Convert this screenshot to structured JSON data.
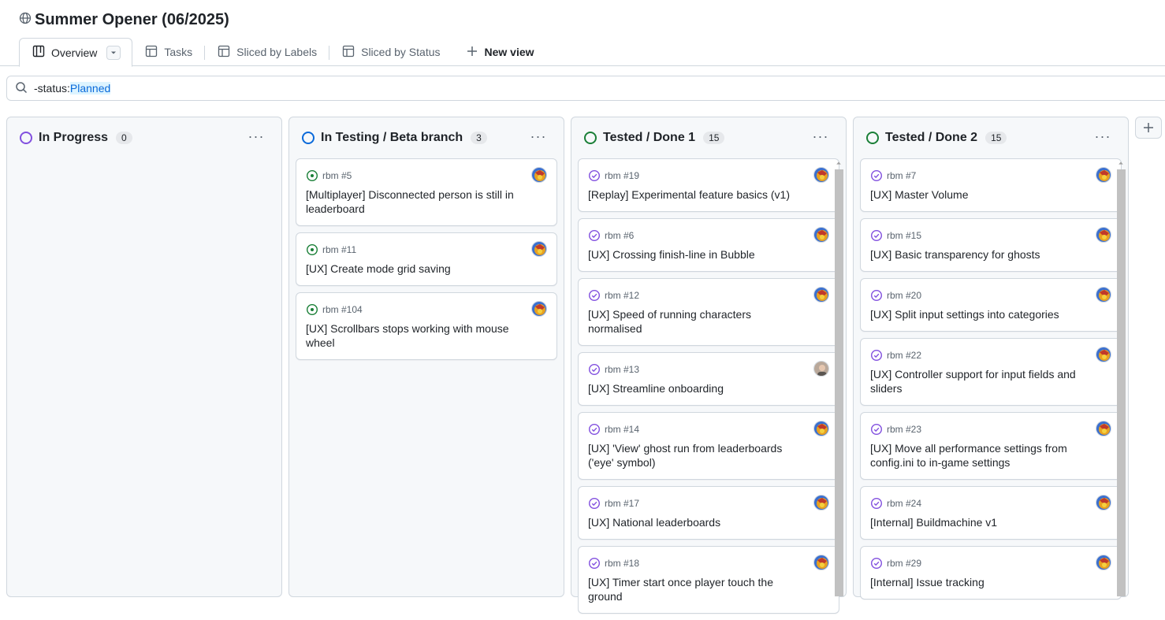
{
  "project": {
    "title": "Summer Opener (06/2025)"
  },
  "tabs": [
    {
      "label": "Overview",
      "icon": "board-icon",
      "active": true
    },
    {
      "label": "Tasks",
      "icon": "table-icon"
    },
    {
      "label": "Sliced by Labels",
      "icon": "table-icon"
    },
    {
      "label": "Sliced by Status",
      "icon": "table-icon"
    }
  ],
  "new_view_label": "New view",
  "filter": {
    "key": "-status:",
    "value": "Planned"
  },
  "columns": [
    {
      "name": "In Progress",
      "count": "0",
      "color": "#8250df",
      "cards": []
    },
    {
      "name": "In Testing / Beta branch",
      "count": "3",
      "color": "#0969da",
      "cards": [
        {
          "repo": "rbm #5",
          "title": "[Multiplayer] Disconnected person is still in leaderboard",
          "state": "open"
        },
        {
          "repo": "rbm #11",
          "title": "[UX] Create mode grid saving",
          "state": "open"
        },
        {
          "repo": "rbm #104",
          "title": "[UX] Scrollbars stops working with mouse wheel",
          "state": "open"
        }
      ]
    },
    {
      "name": "Tested / Done 1",
      "count": "15",
      "color": "#1a7f37",
      "cards": [
        {
          "repo": "rbm #19",
          "title": "[Replay] Experimental feature basics (v1)",
          "state": "done"
        },
        {
          "repo": "rbm #6",
          "title": "[UX] Crossing finish-line in Bubble",
          "state": "done"
        },
        {
          "repo": "rbm #12",
          "title": "[UX] Speed of running characters normalised",
          "state": "done"
        },
        {
          "repo": "rbm #13",
          "title": "[UX] Streamline onboarding",
          "state": "done",
          "avatar": "photo"
        },
        {
          "repo": "rbm #14",
          "title": "[UX] 'View' ghost run from leaderboards ('eye' symbol)",
          "state": "done"
        },
        {
          "repo": "rbm #17",
          "title": "[UX] National leaderboards",
          "state": "done"
        },
        {
          "repo": "rbm #18",
          "title": "[UX] Timer start once player touch the ground",
          "state": "done"
        }
      ]
    },
    {
      "name": "Tested / Done 2",
      "count": "15",
      "color": "#1a7f37",
      "cards": [
        {
          "repo": "rbm #7",
          "title": "[UX] Master Volume",
          "state": "done"
        },
        {
          "repo": "rbm #15",
          "title": "[UX] Basic transparency for ghosts",
          "state": "done"
        },
        {
          "repo": "rbm #20",
          "title": "[UX] Split input settings into categories",
          "state": "done"
        },
        {
          "repo": "rbm #22",
          "title": "[UX] Controller support for input fields and sliders",
          "state": "done"
        },
        {
          "repo": "rbm #23",
          "title": "[UX] Move all performance settings from config.ini to in-game settings",
          "state": "done"
        },
        {
          "repo": "rbm #24",
          "title": "[Internal] Buildmachine v1",
          "state": "done"
        },
        {
          "repo": "rbm #29",
          "title": "[Internal] Issue tracking",
          "state": "done"
        }
      ]
    }
  ]
}
